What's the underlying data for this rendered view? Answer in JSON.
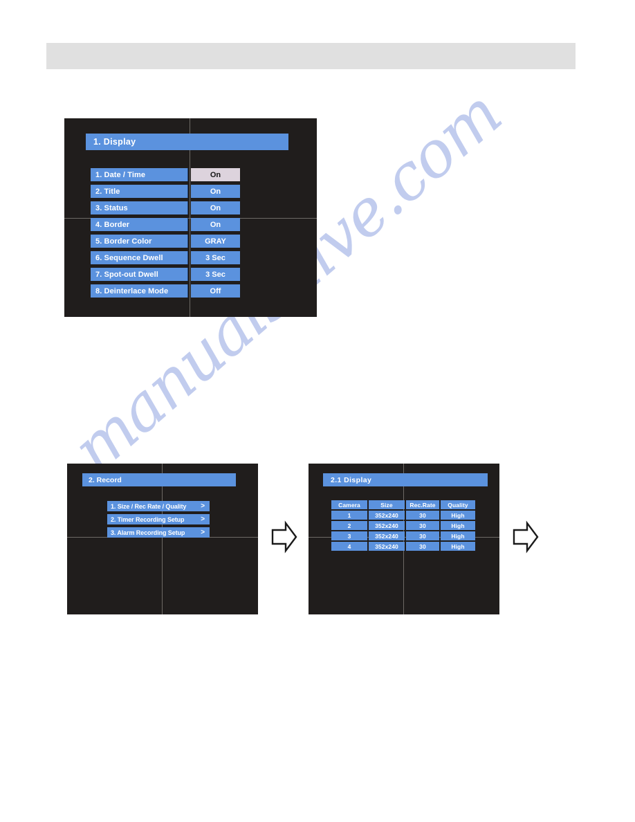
{
  "page": {
    "watermark": "manualshive.com",
    "header_band_label": ""
  },
  "colors": {
    "osd_background": "#201d1c",
    "osd_blue": "#5b92de",
    "osd_selected": "#ddd3dd",
    "osd_text": "#ffffff",
    "osd_gridline": "#6e6a66",
    "header_band": "#e0e0e0",
    "watermark": "#b9c6ec"
  },
  "panel_display": {
    "title": "1. Display",
    "rows": [
      {
        "label": "1. Date / Time",
        "value": "On",
        "selected": true
      },
      {
        "label": "2. Title",
        "value": "On",
        "selected": false
      },
      {
        "label": "3. Status",
        "value": "On",
        "selected": false
      },
      {
        "label": "4. Border",
        "value": "On",
        "selected": false
      },
      {
        "label": "5. Border Color",
        "value": "GRAY",
        "selected": false
      },
      {
        "label": "6. Sequence Dwell",
        "value": "3 Sec",
        "selected": false
      },
      {
        "label": "7. Spot-out Dwell",
        "value": "3 Sec",
        "selected": false
      },
      {
        "label": "8. Deinterlace Mode",
        "value": "Off",
        "selected": false
      }
    ]
  },
  "panel_record": {
    "title": "2. Record",
    "items": [
      {
        "label": "1. Size / Rec Rate / Quality",
        "chevron": ">"
      },
      {
        "label": "2. Timer Recording Setup",
        "chevron": ">"
      },
      {
        "label": "3. Alarm Recording Setup",
        "chevron": ">"
      }
    ]
  },
  "panel_rec_table": {
    "title": "2.1  Display",
    "columns": [
      "Camera",
      "Size",
      "Rec.Rate",
      "Quality"
    ],
    "rows": [
      [
        "1",
        "352x240",
        "30",
        "High"
      ],
      [
        "2",
        "352x240",
        "30",
        "High"
      ],
      [
        "3",
        "352x240",
        "30",
        "High"
      ],
      [
        "4",
        "352x240",
        "30",
        "High"
      ]
    ]
  },
  "arrows": {
    "arrow_1": "right-arrow",
    "arrow_2": "right-arrow"
  }
}
